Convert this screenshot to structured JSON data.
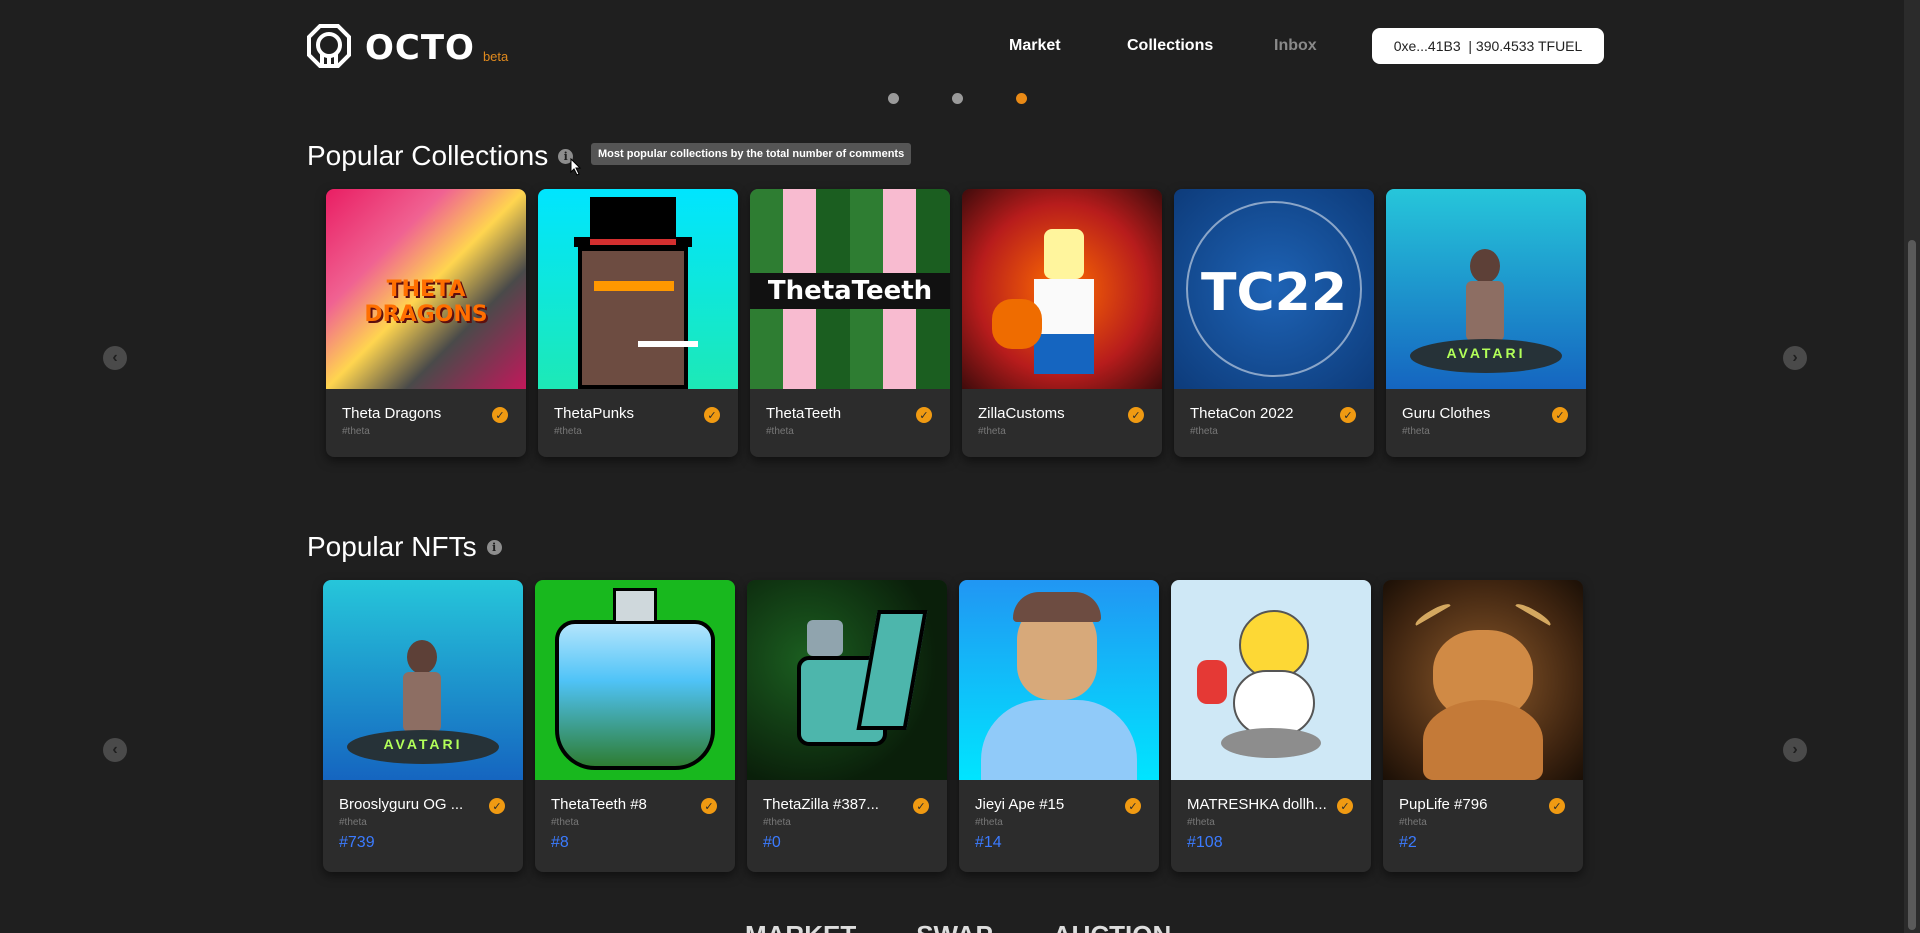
{
  "brand": {
    "name": "OCTO",
    "badge": "beta",
    "accent": "#e98a16"
  },
  "nav": {
    "market": "Market",
    "collections": "Collections",
    "inbox": "Inbox"
  },
  "wallet": {
    "label": "0xe...41B3  | 390.4533 TFUEL"
  },
  "carousel": {
    "dots": 3,
    "active_index": 2
  },
  "popular_collections": {
    "title": "Popular Collections",
    "info_glyph": "i",
    "tooltip": "Most popular collections by the total number of comments",
    "items": [
      {
        "name": "Theta Dragons",
        "tag": "#theta",
        "verified": true,
        "thumb_text": "THETA DRAGONS"
      },
      {
        "name": "ThetaPunks",
        "tag": "#theta",
        "verified": true
      },
      {
        "name": "ThetaTeeth",
        "tag": "#theta",
        "verified": true,
        "thumb_text": "ThetaTeeth"
      },
      {
        "name": "ZillaCustoms",
        "tag": "#theta",
        "verified": true
      },
      {
        "name": "ThetaCon 2022",
        "tag": "#theta",
        "verified": true,
        "thumb_text": "TC22"
      },
      {
        "name": "Guru Clothes",
        "tag": "#theta",
        "verified": true,
        "thumb_text": "AVATARI"
      }
    ]
  },
  "popular_nfts": {
    "title": "Popular NFTs",
    "info_glyph": "i",
    "items": [
      {
        "name": "Brooslyguru OG ...",
        "tag": "#theta",
        "number": "#739",
        "verified": true,
        "thumb_text": "AVATARI"
      },
      {
        "name": "ThetaTeeth #8",
        "tag": "#theta",
        "number": "#8",
        "verified": true
      },
      {
        "name": "ThetaZilla #387...",
        "tag": "#theta",
        "number": "#0",
        "verified": true
      },
      {
        "name": "Jieyi Ape #15",
        "tag": "#theta",
        "number": "#14",
        "verified": true
      },
      {
        "name": "MATRESHKA dollh...",
        "tag": "#theta",
        "number": "#108",
        "verified": true
      },
      {
        "name": "PupLife #796",
        "tag": "#theta",
        "number": "#2",
        "verified": true
      }
    ]
  },
  "bottom_tabs": [
    "MARKET",
    "SWAP",
    "AUCTION"
  ],
  "icons": {
    "prev": "chevron-left-icon",
    "next": "chevron-right-icon",
    "check": "check-badge-icon",
    "prev_glyph": "‹",
    "next_glyph": "›",
    "check_glyph": "✓"
  }
}
